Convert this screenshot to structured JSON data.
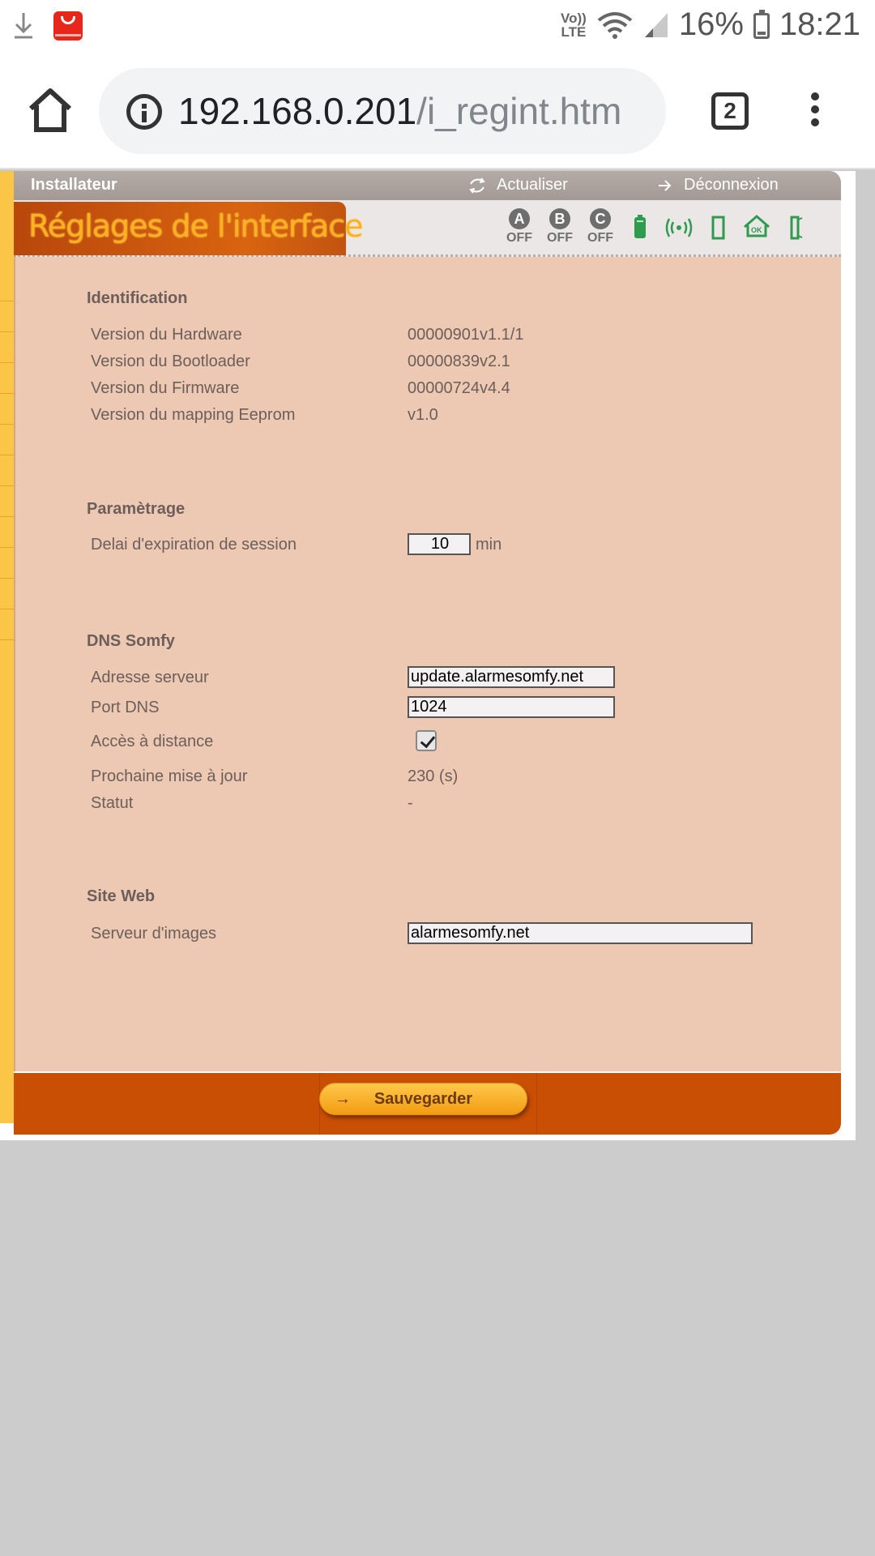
{
  "status_bar": {
    "network_label_top": "Vo))",
    "network_label_bottom": "LTE",
    "battery_percent": "16%",
    "time": "18:21"
  },
  "browser": {
    "url_host": "192.168.0.201",
    "url_path": "/i_regint.htm",
    "tab_count": "2"
  },
  "page": {
    "role": "Installateur",
    "refresh_label": "Actualiser",
    "logout_label": "Déconnexion",
    "title": "Réglages de l'interface",
    "zones": [
      {
        "letter": "A",
        "state": "OFF"
      },
      {
        "letter": "B",
        "state": "OFF"
      },
      {
        "letter": "C",
        "state": "OFF"
      }
    ],
    "status_icons": [
      "battery-icon",
      "radio-signal-icon",
      "door-icon",
      "house-ok-icon",
      "opening-icon"
    ],
    "accent_color": "#c84f04",
    "content_background": "#edc8b2"
  },
  "identification": {
    "title": "Identification",
    "rows": [
      {
        "label": "Version du Hardware",
        "value": "00000901v1.1/1"
      },
      {
        "label": "Version du Bootloader",
        "value": "00000839v2.1"
      },
      {
        "label": "Version du Firmware",
        "value": "00000724v4.4"
      },
      {
        "label": "Version du mapping Eeprom",
        "value": "v1.0"
      }
    ]
  },
  "parametrage": {
    "title": "Paramètrage",
    "session_label": "Delai d'expiration de session",
    "session_value": "10",
    "session_unit": "min"
  },
  "dns": {
    "title": "DNS Somfy",
    "server_label": "Adresse serveur",
    "server_value": "update.alarmesomfy.net",
    "port_label": "Port DNS",
    "port_value": "1024",
    "remote_label": "Accès à distance",
    "remote_checked": true,
    "next_update_label": "Prochaine mise à jour",
    "next_update_value": "230 (s)",
    "status_label": "Statut",
    "status_value": "-"
  },
  "website": {
    "title": "Site Web",
    "image_server_label": "Serveur d'images",
    "image_server_value": "alarmesomfy.net"
  },
  "footer": {
    "save_label": "Sauvegarder"
  }
}
